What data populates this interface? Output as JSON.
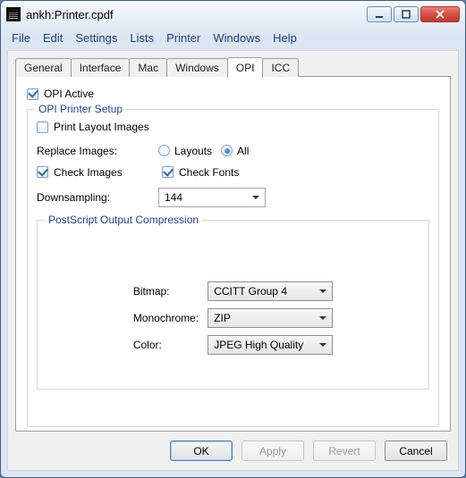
{
  "title": "ankh:Printer.cpdf",
  "menu": [
    "File",
    "Edit",
    "Settings",
    "Lists",
    "Printer",
    "Windows",
    "Help"
  ],
  "tabs": [
    "General",
    "Interface",
    "Mac",
    "Windows",
    "OPI",
    "ICC"
  ],
  "active_tab": "OPI",
  "opi": {
    "active_label": "OPI Active",
    "active_checked": true,
    "group_title": "OPI Printer Setup",
    "print_layout_label": "Print Layout Images",
    "print_layout_checked": false,
    "replace_label": "Replace Images:",
    "replace_layouts": "Layouts",
    "replace_all": "All",
    "replace_selected": "All",
    "check_images_label": "Check Images",
    "check_images_checked": true,
    "check_fonts_label": "Check Fonts",
    "check_fonts_checked": true,
    "downsampling_label": "Downsampling:",
    "downsampling_value": "144",
    "ps_group_title": "PostScript Output Compression",
    "bitmap_label": "Bitmap:",
    "bitmap_value": "CCITT Group 4",
    "mono_label": "Monochrome:",
    "mono_value": "ZIP",
    "color_label": "Color:",
    "color_value": "JPEG High Quality"
  },
  "buttons": {
    "ok": "OK",
    "apply": "Apply",
    "revert": "Revert",
    "cancel": "Cancel"
  }
}
